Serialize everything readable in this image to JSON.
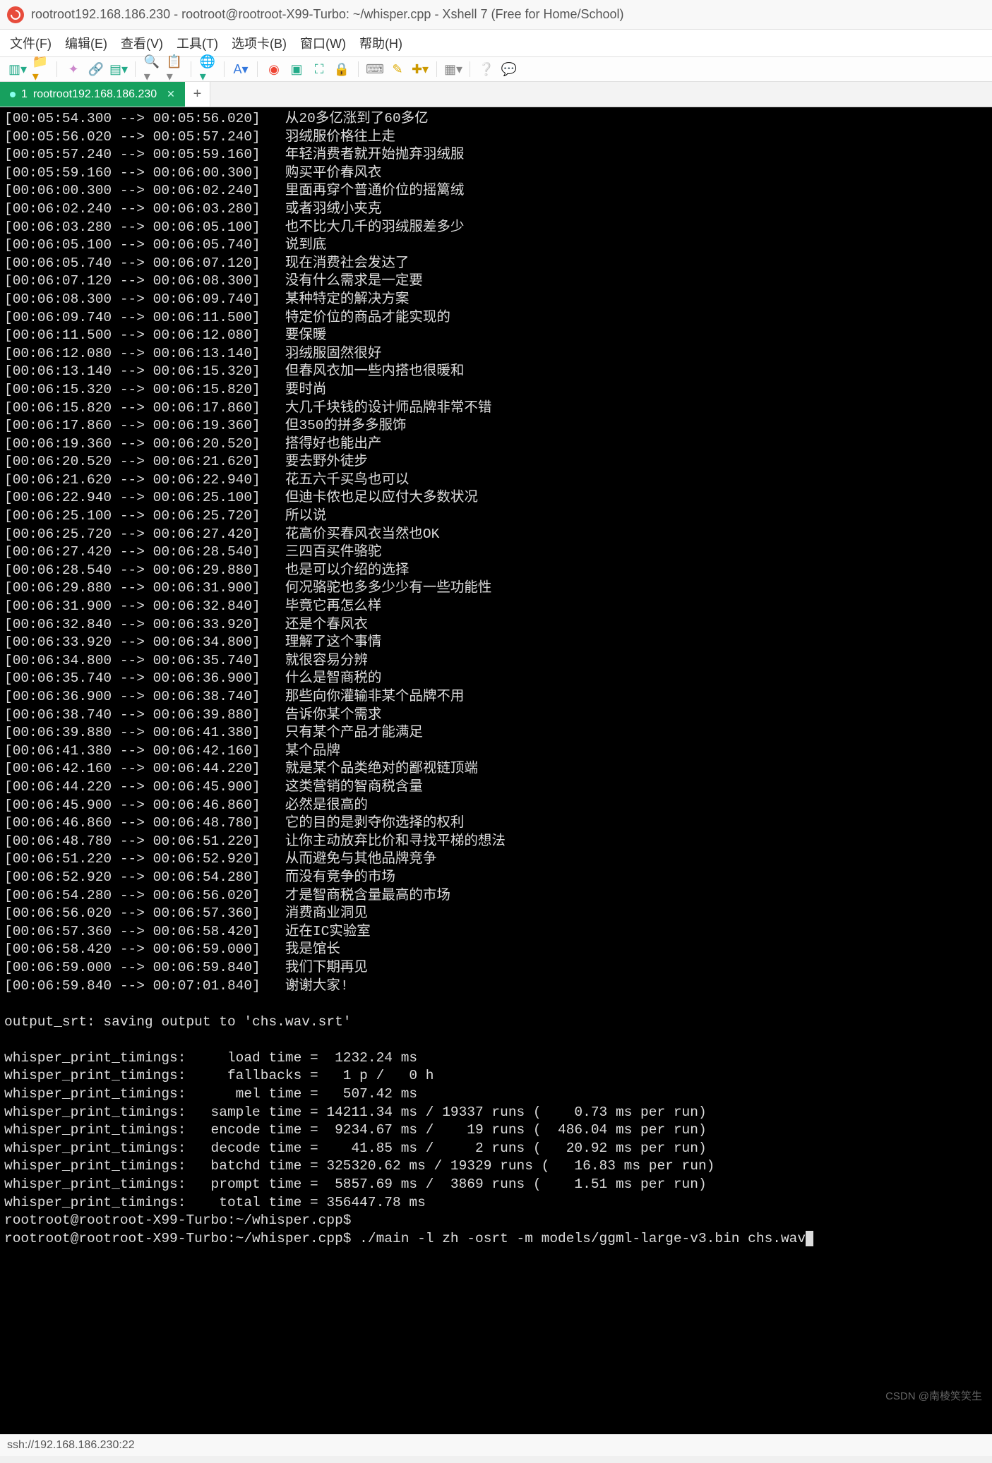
{
  "window": {
    "title": "rootroot192.168.186.230 - rootroot@rootroot-X99-Turbo: ~/whisper.cpp - Xshell 7 (Free for Home/School)"
  },
  "menubar": {
    "items": [
      "文件(F)",
      "编辑(E)",
      "查看(V)",
      "工具(T)",
      "选项卡(B)",
      "窗口(W)",
      "帮助(H)"
    ]
  },
  "toolbar": {
    "icons": [
      "new-session-icon",
      "open-icon",
      "sep",
      "reconnect-icon",
      "link-icon",
      "properties-icon",
      "sep",
      "search-icon",
      "clipboard-icon",
      "sep",
      "globe-icon",
      "sep",
      "font-icon",
      "sep",
      "macro-icon",
      "record-icon",
      "fullscreen-icon",
      "lock-icon",
      "sep",
      "keyboard-icon",
      "highlight-icon",
      "add-icon",
      "sep",
      "theme-icon",
      "sep",
      "help-icon",
      "chat-icon"
    ]
  },
  "tabs": {
    "active": {
      "index": "1",
      "label": "rootroot192.168.186.230"
    }
  },
  "terminal": {
    "transcript": [
      {
        "ts": "[00:05:54.300 --> 00:05:56.020]",
        "txt": "从20多亿涨到了60多亿"
      },
      {
        "ts": "[00:05:56.020 --> 00:05:57.240]",
        "txt": "羽绒服价格往上走"
      },
      {
        "ts": "[00:05:57.240 --> 00:05:59.160]",
        "txt": "年轻消费者就开始抛弃羽绒服"
      },
      {
        "ts": "[00:05:59.160 --> 00:06:00.300]",
        "txt": "购买平价春风衣"
      },
      {
        "ts": "[00:06:00.300 --> 00:06:02.240]",
        "txt": "里面再穿个普通价位的摇篱绒"
      },
      {
        "ts": "[00:06:02.240 --> 00:06:03.280]",
        "txt": "或者羽绒小夹克"
      },
      {
        "ts": "[00:06:03.280 --> 00:06:05.100]",
        "txt": "也不比大几千的羽绒服差多少"
      },
      {
        "ts": "[00:06:05.100 --> 00:06:05.740]",
        "txt": "说到底"
      },
      {
        "ts": "[00:06:05.740 --> 00:06:07.120]",
        "txt": "现在消费社会发达了"
      },
      {
        "ts": "[00:06:07.120 --> 00:06:08.300]",
        "txt": "没有什么需求是一定要"
      },
      {
        "ts": "[00:06:08.300 --> 00:06:09.740]",
        "txt": "某种特定的解决方案"
      },
      {
        "ts": "[00:06:09.740 --> 00:06:11.500]",
        "txt": "特定价位的商品才能实现的"
      },
      {
        "ts": "[00:06:11.500 --> 00:06:12.080]",
        "txt": "要保暖"
      },
      {
        "ts": "[00:06:12.080 --> 00:06:13.140]",
        "txt": "羽绒服固然很好"
      },
      {
        "ts": "[00:06:13.140 --> 00:06:15.320]",
        "txt": "但春风衣加一些内搭也很暖和"
      },
      {
        "ts": "[00:06:15.320 --> 00:06:15.820]",
        "txt": "要时尚"
      },
      {
        "ts": "[00:06:15.820 --> 00:06:17.860]",
        "txt": "大几千块钱的设计师品牌非常不错"
      },
      {
        "ts": "[00:06:17.860 --> 00:06:19.360]",
        "txt": "但350的拼多多服饰"
      },
      {
        "ts": "[00:06:19.360 --> 00:06:20.520]",
        "txt": "搭得好也能出产"
      },
      {
        "ts": "[00:06:20.520 --> 00:06:21.620]",
        "txt": "要去野外徒步"
      },
      {
        "ts": "[00:06:21.620 --> 00:06:22.940]",
        "txt": "花五六千买鸟也可以"
      },
      {
        "ts": "[00:06:22.940 --> 00:06:25.100]",
        "txt": "但迪卡侬也足以应付大多数状况"
      },
      {
        "ts": "[00:06:25.100 --> 00:06:25.720]",
        "txt": "所以说"
      },
      {
        "ts": "[00:06:25.720 --> 00:06:27.420]",
        "txt": "花高价买春风衣当然也OK"
      },
      {
        "ts": "[00:06:27.420 --> 00:06:28.540]",
        "txt": "三四百买件骆驼"
      },
      {
        "ts": "[00:06:28.540 --> 00:06:29.880]",
        "txt": "也是可以介绍的选择"
      },
      {
        "ts": "[00:06:29.880 --> 00:06:31.900]",
        "txt": "何况骆驼也多多少少有一些功能性"
      },
      {
        "ts": "[00:06:31.900 --> 00:06:32.840]",
        "txt": "毕竟它再怎么样"
      },
      {
        "ts": "[00:06:32.840 --> 00:06:33.920]",
        "txt": "还是个春风衣"
      },
      {
        "ts": "[00:06:33.920 --> 00:06:34.800]",
        "txt": "理解了这个事情"
      },
      {
        "ts": "[00:06:34.800 --> 00:06:35.740]",
        "txt": "就很容易分辨"
      },
      {
        "ts": "[00:06:35.740 --> 00:06:36.900]",
        "txt": "什么是智商税的"
      },
      {
        "ts": "[00:06:36.900 --> 00:06:38.740]",
        "txt": "那些向你灌输非某个品牌不用"
      },
      {
        "ts": "[00:06:38.740 --> 00:06:39.880]",
        "txt": "告诉你某个需求"
      },
      {
        "ts": "[00:06:39.880 --> 00:06:41.380]",
        "txt": "只有某个产品才能满足"
      },
      {
        "ts": "[00:06:41.380 --> 00:06:42.160]",
        "txt": "某个品牌"
      },
      {
        "ts": "[00:06:42.160 --> 00:06:44.220]",
        "txt": "就是某个品类绝对的鄙视链顶端"
      },
      {
        "ts": "[00:06:44.220 --> 00:06:45.900]",
        "txt": "这类营销的智商税含量"
      },
      {
        "ts": "[00:06:45.900 --> 00:06:46.860]",
        "txt": "必然是很高的"
      },
      {
        "ts": "[00:06:46.860 --> 00:06:48.780]",
        "txt": "它的目的是剥夺你选择的权利"
      },
      {
        "ts": "[00:06:48.780 --> 00:06:51.220]",
        "txt": "让你主动放弃比价和寻找平梯的想法"
      },
      {
        "ts": "[00:06:51.220 --> 00:06:52.920]",
        "txt": "从而避免与其他品牌竞争"
      },
      {
        "ts": "[00:06:52.920 --> 00:06:54.280]",
        "txt": "而没有竞争的市场"
      },
      {
        "ts": "[00:06:54.280 --> 00:06:56.020]",
        "txt": "才是智商税含量最高的市场"
      },
      {
        "ts": "[00:06:56.020 --> 00:06:57.360]",
        "txt": "消费商业洞见"
      },
      {
        "ts": "[00:06:57.360 --> 00:06:58.420]",
        "txt": "近在IC实验室"
      },
      {
        "ts": "[00:06:58.420 --> 00:06:59.000]",
        "txt": "我是馆长"
      },
      {
        "ts": "[00:06:59.000 --> 00:06:59.840]",
        "txt": "我们下期再见"
      },
      {
        "ts": "[00:06:59.840 --> 00:07:01.840]",
        "txt": "谢谢大家!"
      }
    ],
    "output_srt": "output_srt: saving output to 'chs.wav.srt'",
    "timings": [
      "whisper_print_timings:     load time =  1232.24 ms",
      "whisper_print_timings:     fallbacks =   1 p /   0 h",
      "whisper_print_timings:      mel time =   507.42 ms",
      "whisper_print_timings:   sample time = 14211.34 ms / 19337 runs (    0.73 ms per run)",
      "whisper_print_timings:   encode time =  9234.67 ms /    19 runs (  486.04 ms per run)",
      "whisper_print_timings:   decode time =    41.85 ms /     2 runs (   20.92 ms per run)",
      "whisper_print_timings:   batchd time = 325320.62 ms / 19329 runs (   16.83 ms per run)",
      "whisper_print_timings:   prompt time =  5857.69 ms /  3869 runs (    1.51 ms per run)",
      "whisper_print_timings:    total time = 356447.78 ms"
    ],
    "prompt1": "rootroot@rootroot-X99-Turbo:~/whisper.cpp$",
    "prompt2_prefix": "rootroot@rootroot-X99-Turbo:~/whisper.cpp$ ",
    "prompt2_cmd": "./main -l zh -osrt -m models/ggml-large-v3.bin chs.wav"
  },
  "statusbar": {
    "left": "ssh://192.168.186.230:22"
  },
  "watermark": "CSDN @南棱笑笑生"
}
